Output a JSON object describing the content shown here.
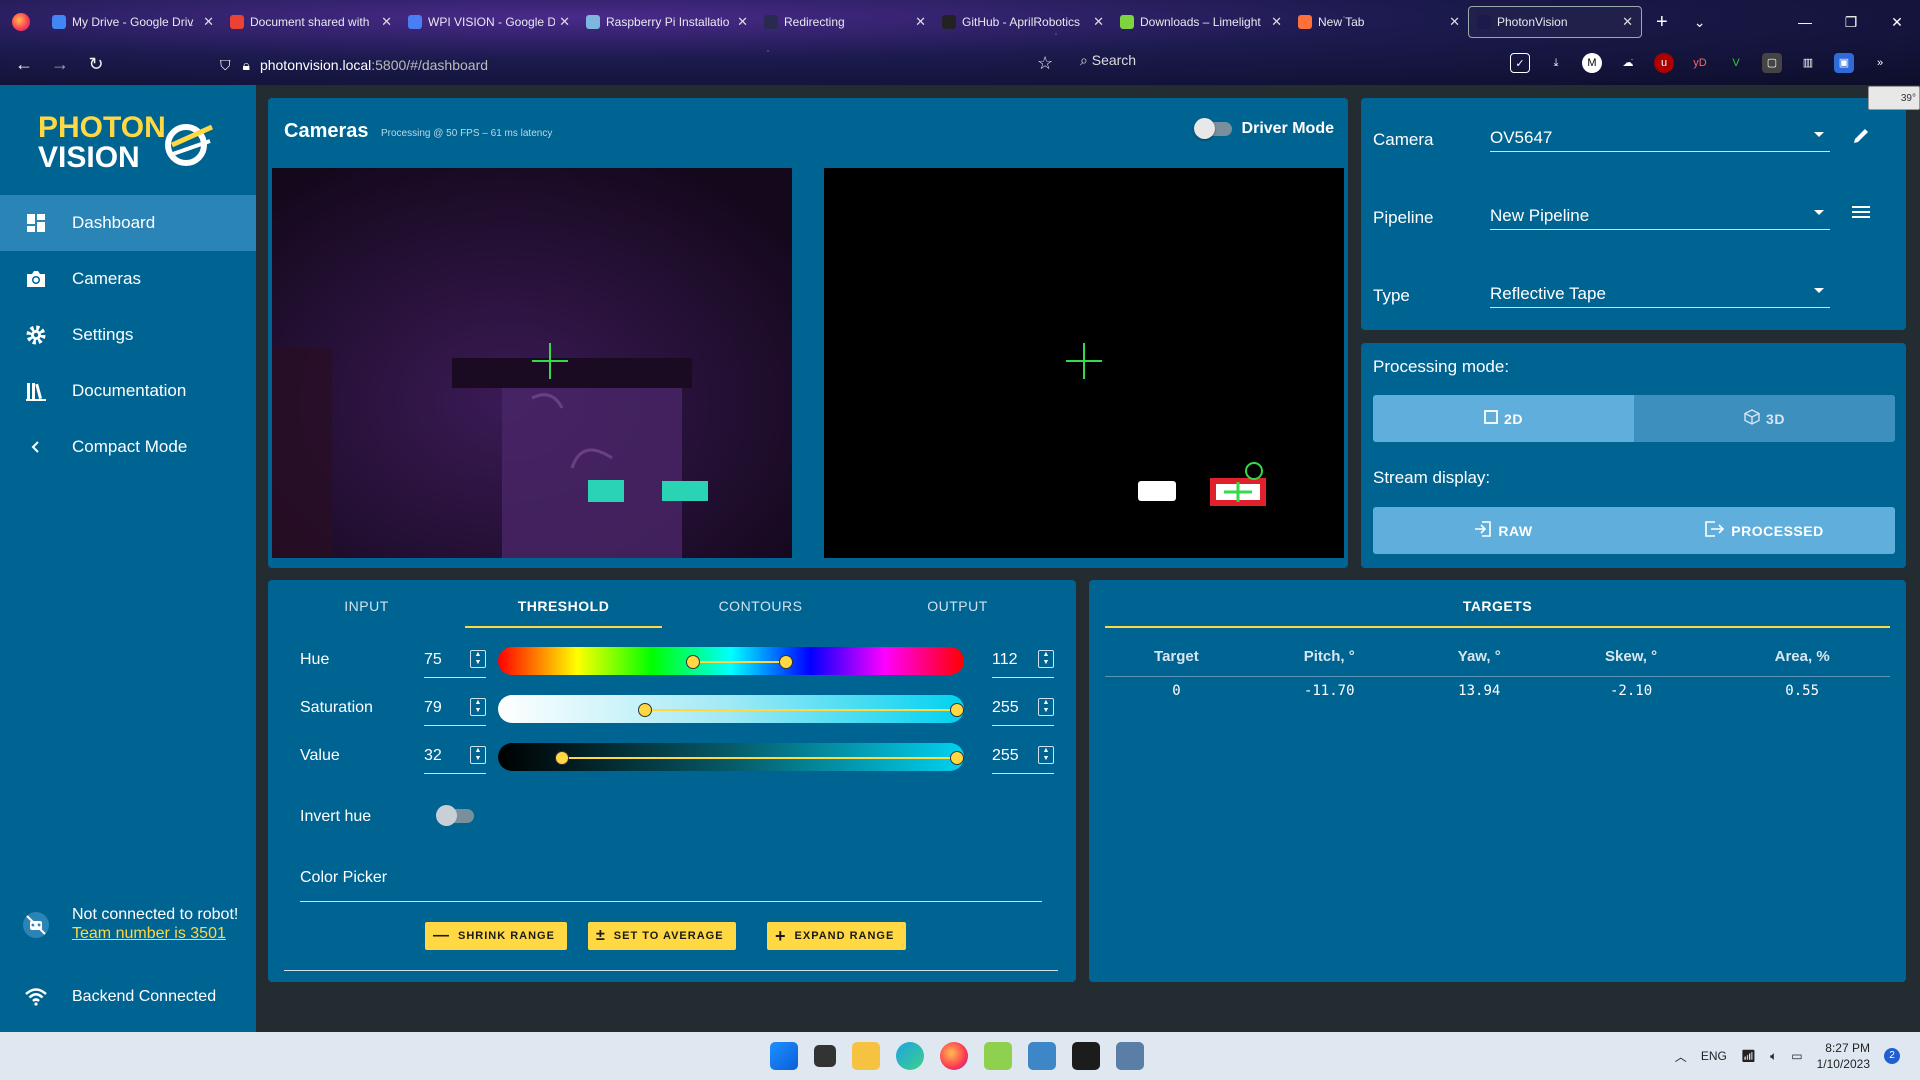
{
  "browser": {
    "tabs": [
      {
        "label": "My Drive - Google Driv",
        "fav_color": "#4285f4"
      },
      {
        "label": "Document shared with",
        "fav_color": "#ea4335"
      },
      {
        "label": "WPI VISION - Google D",
        "fav_color": "#4a7ef5"
      },
      {
        "label": "Raspberry Pi Installatio",
        "fav_color": "#7fb6e0"
      },
      {
        "label": "Redirecting",
        "fav_color": "#2a2a50"
      },
      {
        "label": "GitHub - AprilRobotics",
        "fav_color": "#222222"
      },
      {
        "label": "Downloads – Limelight",
        "fav_color": "#7fd33e"
      },
      {
        "label": "New Tab",
        "fav_color": "#ff7139"
      },
      {
        "label": "PhotonVision",
        "fav_color": "#1b1a4d"
      }
    ],
    "url_host": "photonvision.local",
    "url_path": ":5800/#/dashboard",
    "search_placeholder": "Search",
    "weather": "39°"
  },
  "sidebar": {
    "logo_line1": "PHOTON",
    "logo_line2": "VISION",
    "items": [
      {
        "label": "Dashboard",
        "icon": "dashboard-icon"
      },
      {
        "label": "Cameras",
        "icon": "camera-icon"
      },
      {
        "label": "Settings",
        "icon": "gear-icon"
      },
      {
        "label": "Documentation",
        "icon": "books-icon"
      },
      {
        "label": "Compact Mode",
        "icon": "chevron-left-icon"
      }
    ],
    "robot_status": "Not connected to robot!",
    "team_number": "Team number is 3501",
    "backend_status": "Backend Connected"
  },
  "cameras_card": {
    "title": "Cameras",
    "subtitle": "Processing @ 50 FPS – 61 ms latency",
    "driver_mode_label": "Driver Mode",
    "driver_mode_on": false
  },
  "camera_settings": {
    "camera_label": "Camera",
    "camera_value": "OV5647",
    "pipeline_label": "Pipeline",
    "pipeline_value": "New Pipeline",
    "type_label": "Type",
    "type_value": "Reflective Tape"
  },
  "processing": {
    "mode_label": "Processing mode:",
    "mode_2d": "2D",
    "mode_3d": "3D",
    "selected_mode": "2D",
    "stream_label": "Stream display:",
    "raw": "RAW",
    "processed": "PROCESSED"
  },
  "threshold": {
    "tabs": [
      "INPUT",
      "THRESHOLD",
      "CONTOURS",
      "OUTPUT"
    ],
    "active_tab": "THRESHOLD",
    "hue": {
      "label": "Hue",
      "min": 75,
      "max": 112,
      "range_max": 180
    },
    "saturation": {
      "label": "Saturation",
      "min": 79,
      "max": 255,
      "range_max": 255
    },
    "value": {
      "label": "Value",
      "min": 32,
      "max": 255,
      "range_max": 255
    },
    "invert_hue_label": "Invert hue",
    "invert_hue_on": false,
    "color_picker_label": "Color Picker",
    "shrink_label": "SHRINK RANGE",
    "average_label": "SET TO AVERAGE",
    "expand_label": "EXPAND RANGE"
  },
  "targets": {
    "title": "TARGETS",
    "columns": [
      "Target",
      "Pitch, °",
      "Yaw, °",
      "Skew, °",
      "Area, %"
    ],
    "rows": [
      [
        "0",
        "-11.70",
        "13.94",
        "-2.10",
        "0.55"
      ]
    ]
  },
  "taskbar": {
    "language": "ENG",
    "time": "8:27 PM",
    "date": "1/10/2023",
    "notifications": "2"
  },
  "colors": {
    "accent": "#ffd843",
    "panel": "#006492",
    "background": "#232c31",
    "active_nav": "#2b84b6"
  }
}
